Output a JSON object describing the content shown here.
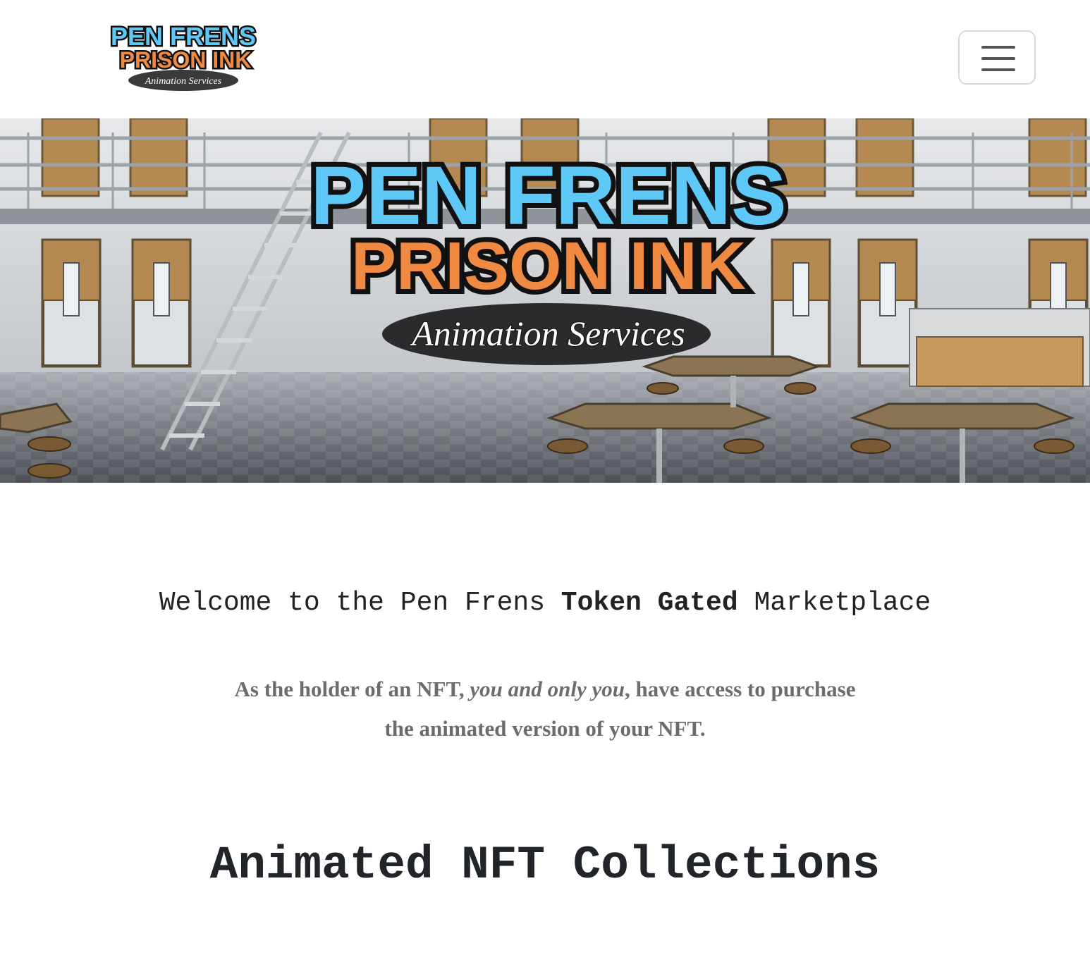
{
  "nav": {
    "logo": {
      "line1": "PEN FRENS",
      "line2": "PRISON INK",
      "tagline": "Animation Services"
    },
    "menu_toggle_icon": "hamburger-menu-icon"
  },
  "hero": {
    "logo": {
      "line1": "PEN FRENS",
      "line2": "PRISON INK",
      "tagline": "Animation Services"
    }
  },
  "welcome": {
    "before": "Welcome to the Pen Frens ",
    "bold": "Token Gated",
    "after": " Marketplace"
  },
  "intro": {
    "part1": "As the holder of an NFT, ",
    "emphasis": "you and only you",
    "part2": ", have access to purchase the animated version of your NFT."
  },
  "section": {
    "title": "Animated NFT Collections"
  },
  "colors": {
    "logo_blue": "#5ec8f7",
    "logo_orange": "#f08a42",
    "text_dark": "#212529",
    "text_gray": "#6c6c6c"
  }
}
